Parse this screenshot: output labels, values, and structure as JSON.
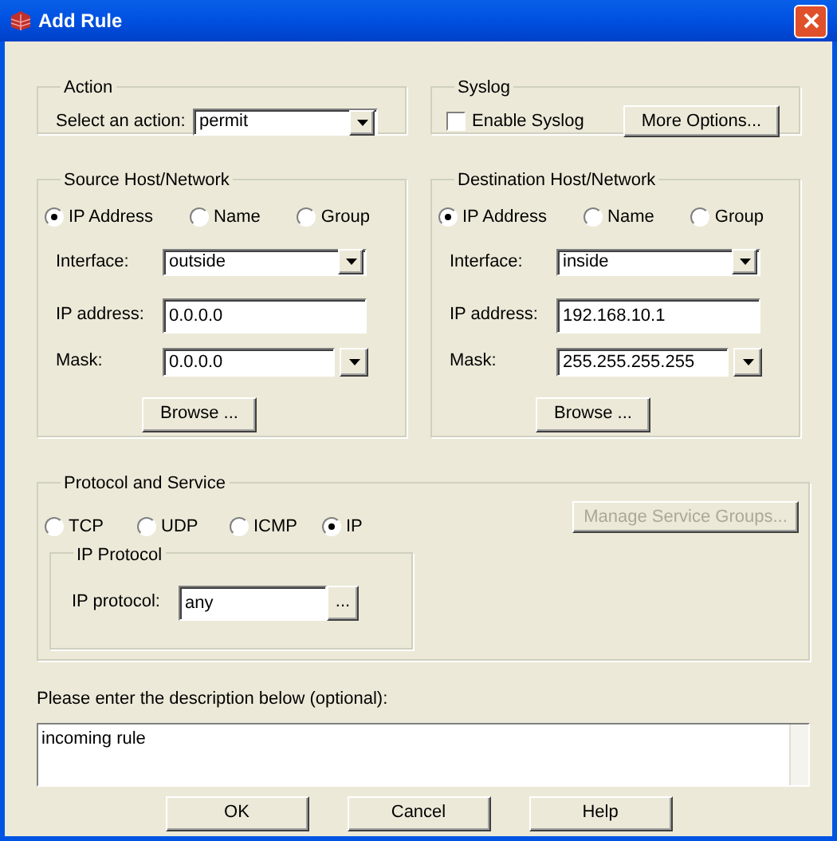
{
  "window": {
    "title": "Add Rule"
  },
  "action": {
    "legend": "Action",
    "label": "Select an action:",
    "value": "permit"
  },
  "syslog": {
    "legend": "Syslog",
    "enable": {
      "label": "Enable Syslog",
      "checked": false
    },
    "button": "More Options..."
  },
  "hosts": [
    {
      "legend": "Source Host/Network",
      "options": [
        {
          "label": "IP Address",
          "selected": true
        },
        {
          "label": "Name",
          "selected": false
        },
        {
          "label": "Group",
          "selected": false
        }
      ],
      "interface": {
        "label": "Interface:",
        "value": "outside"
      },
      "ip": {
        "label": "IP address:",
        "value": "0.0.0.0"
      },
      "mask": {
        "label": "Mask:",
        "value": "0.0.0.0"
      },
      "browse": "Browse ..."
    },
    {
      "legend": "Destination Host/Network",
      "options": [
        {
          "label": "IP Address",
          "selected": true
        },
        {
          "label": "Name",
          "selected": false
        },
        {
          "label": "Group",
          "selected": false
        }
      ],
      "interface": {
        "label": "Interface:",
        "value": "inside"
      },
      "ip": {
        "label": "IP address:",
        "value": "192.168.10.1"
      },
      "mask": {
        "label": "Mask:",
        "value": "255.255.255.255"
      },
      "browse": "Browse ..."
    }
  ],
  "protocol": {
    "legend": "Protocol and Service",
    "options": [
      {
        "label": "TCP",
        "selected": false
      },
      {
        "label": "UDP",
        "selected": false
      },
      {
        "label": "ICMP",
        "selected": false
      },
      {
        "label": "IP",
        "selected": true
      }
    ],
    "manage": {
      "label": "Manage Service Groups...",
      "disabled": true
    },
    "ip_protocol": {
      "legend": "IP Protocol",
      "label": "IP protocol:",
      "value": "any",
      "button": "..."
    }
  },
  "description": {
    "label": "Please enter the description below (optional):",
    "value": "incoming rule"
  },
  "buttons": [
    "OK",
    "Cancel",
    "Help"
  ]
}
